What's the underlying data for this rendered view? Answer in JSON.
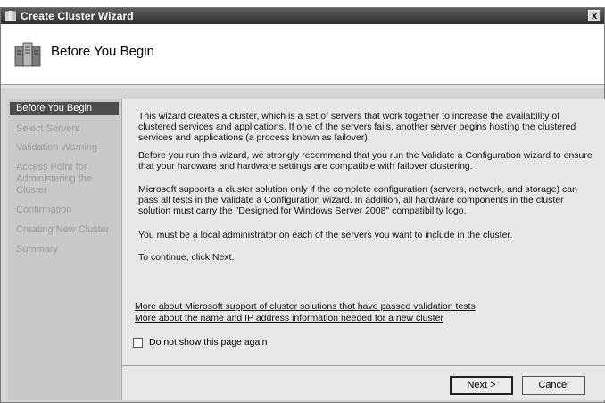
{
  "window": {
    "title": "Create Cluster Wizard",
    "close_glyph": "x"
  },
  "header": {
    "title": "Before You Begin"
  },
  "sidebar": {
    "steps": [
      "Before You Begin",
      "Select Servers",
      "Validation Warning",
      "Access Point for",
      "Administering the",
      "Cluster",
      "Confirmation",
      "Creating New Cluster",
      "Summary"
    ]
  },
  "content": {
    "paragraphs": [
      "This wizard creates a cluster, which is a set of servers that work together to increase the availability of clustered services and applications. If one of the servers fails, another server begins hosting the clustered services and applications (a process known as failover).",
      "Before you run this wizard, we strongly recommend that you run the Validate a Configuration wizard to ensure that your hardware and hardware settings are compatible with failover clustering.",
      "Microsoft supports a cluster solution only if the complete configuration (servers, network, and storage) can pass all tests in the Validate a Configuration wizard.  In addition, all hardware components in the cluster solution must carry the \"Designed for Windows Server 2008\" compatibility logo.",
      "You must be a local administrator on each of the servers you want to include in the cluster.",
      "To continue, click Next."
    ],
    "links": [
      "More about Microsoft support of cluster solutions that have passed validation tests",
      "More about the name and IP address information needed for a new cluster"
    ],
    "checkbox_label": "Do not show this page again",
    "checkbox_checked": false
  },
  "buttons": {
    "next": "Next >",
    "cancel": "Cancel"
  }
}
